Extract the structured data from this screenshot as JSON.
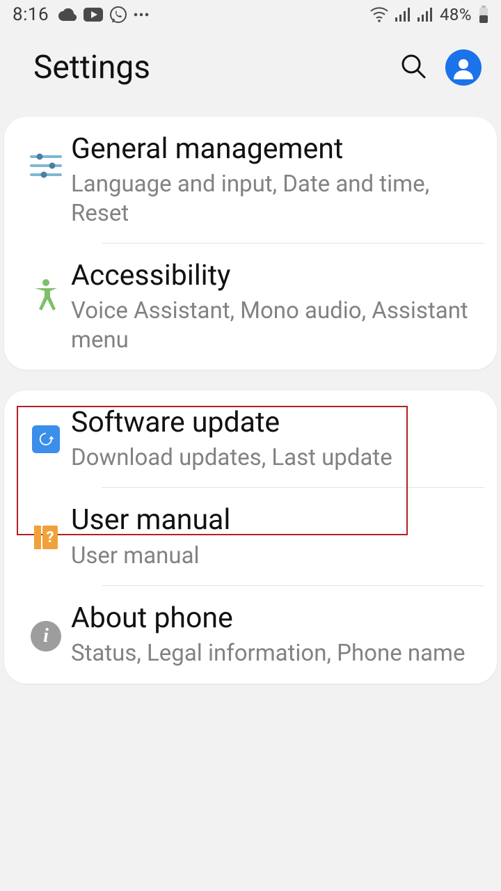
{
  "status": {
    "time": "8:16",
    "battery_pct": "48%"
  },
  "header": {
    "title": "Settings"
  },
  "groups": [
    {
      "items": [
        {
          "title": "General management",
          "subtitle": "Language and input, Date and time, Reset"
        },
        {
          "title": "Accessibility",
          "subtitle": "Voice Assistant, Mono audio, Assistant menu"
        }
      ]
    },
    {
      "items": [
        {
          "title": "Software update",
          "subtitle": "Download updates, Last update",
          "highlighted": true
        },
        {
          "title": "User manual",
          "subtitle": "User manual"
        },
        {
          "title": "About phone",
          "subtitle": "Status, Legal information, Phone name"
        }
      ]
    }
  ]
}
